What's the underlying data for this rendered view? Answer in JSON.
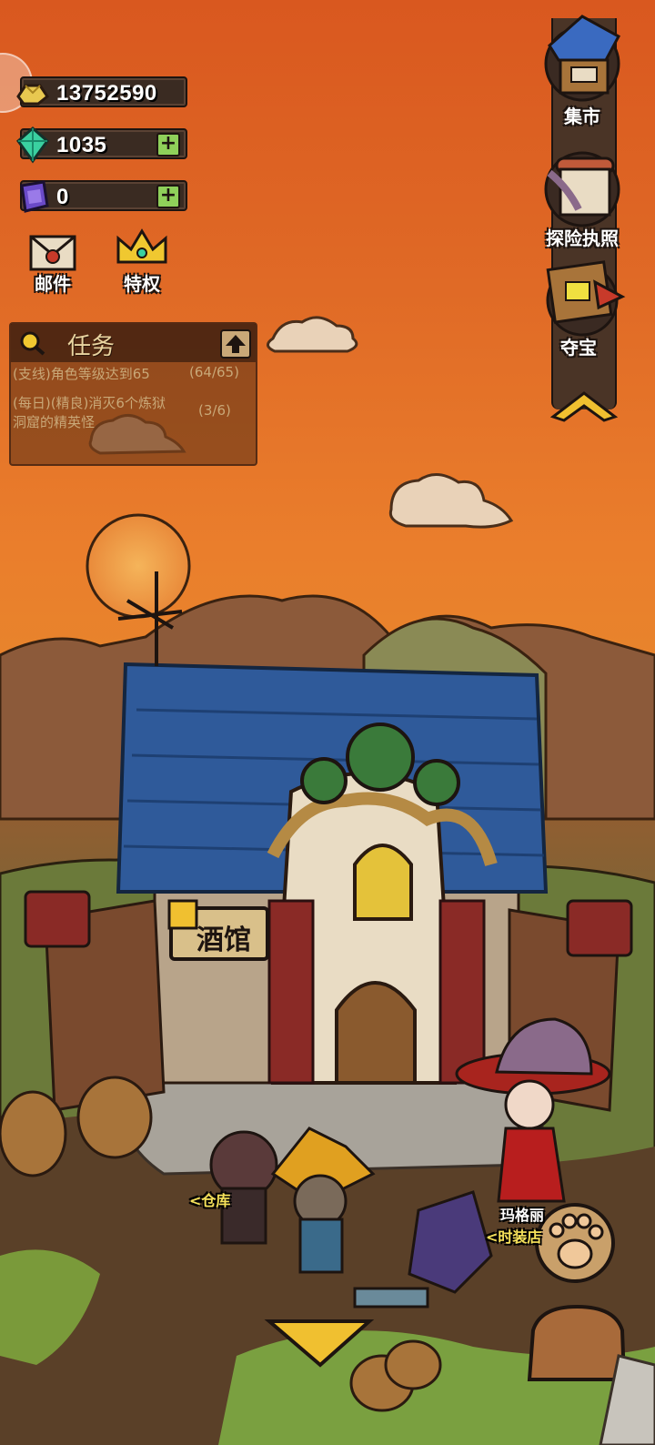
{
  "resources": {
    "gold": "13752590",
    "gems": "1035",
    "crystal": "0"
  },
  "left_buttons": {
    "mail": "邮件",
    "privilege": "特权"
  },
  "quest": {
    "title": "任务",
    "items": [
      {
        "text": "(支线)角色等级达到65",
        "progress": "(64/65)"
      },
      {
        "text_line1": "(每日)(精良)消灭6个炼狱",
        "text_line2": "洞窟的精英怪",
        "progress": "(3/6)"
      }
    ]
  },
  "right_menu": {
    "market": "集市",
    "license": "探险执照",
    "treasure": "夺宝"
  },
  "scene": {
    "tavern_sign": "酒馆",
    "npc_warehouse": "<仓库",
    "npc_fashion_name": "玛格丽",
    "npc_fashion_role": "<时装店"
  },
  "colors": {
    "sky_top": "#d9581f",
    "sky_mid": "#ea7e2c",
    "roof_blue": "#2f5a9a",
    "plus_green": "#8fd05a"
  }
}
